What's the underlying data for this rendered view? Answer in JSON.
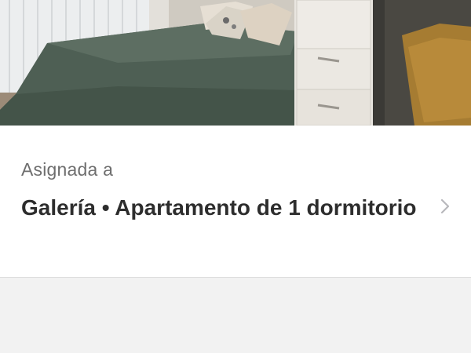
{
  "photo": {
    "icon": "bedroom-photo"
  },
  "card": {
    "label": "Asignada a",
    "title": "Galería • Apartamento de 1 dormitorio",
    "chevron_icon": "chevron-right-icon"
  }
}
